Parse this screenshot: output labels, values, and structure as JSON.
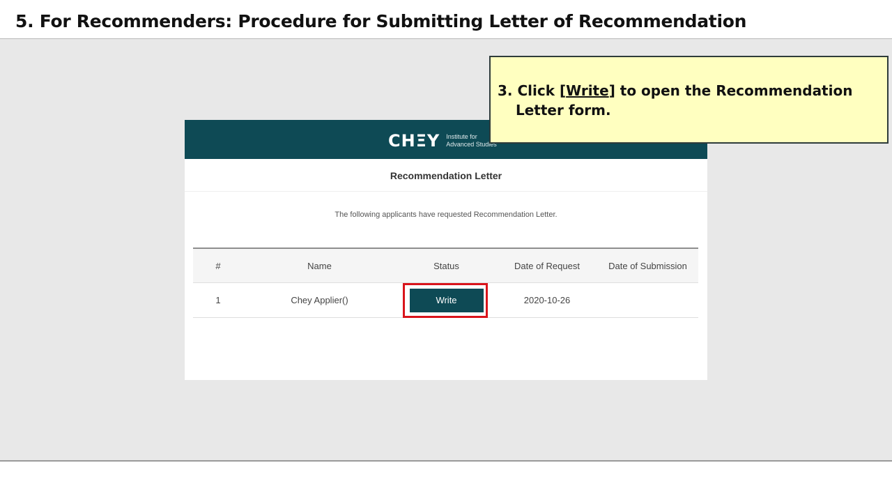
{
  "slide": {
    "title": "5. For Recommenders: Procedure for Submitting Letter of Recommendation"
  },
  "callout": {
    "step": "3. Click ",
    "bracket_open": "[",
    "link_text": "Write",
    "bracket_close": "]",
    "rest_line1": " to open the Recommendation",
    "line2": "Letter form."
  },
  "site": {
    "logo_mark": "CHΞY",
    "logo_line1": "Institute for",
    "logo_line2": "Advanced Studies",
    "page_heading": "Recommendation Letter",
    "intro": "The following applicants have requested Recommendation Letter."
  },
  "table": {
    "headers": [
      "#",
      "Name",
      "Status",
      "Date of Request",
      "Date of Submission"
    ],
    "rows": [
      {
        "num": "1",
        "name": "Chey Applier()",
        "status_button": "Write",
        "date_request": "2020-10-26",
        "date_submission": ""
      }
    ]
  },
  "colors": {
    "header_teal": "#0e4a55",
    "highlight_red": "#d9141b",
    "callout_yellow": "#ffffc0"
  }
}
